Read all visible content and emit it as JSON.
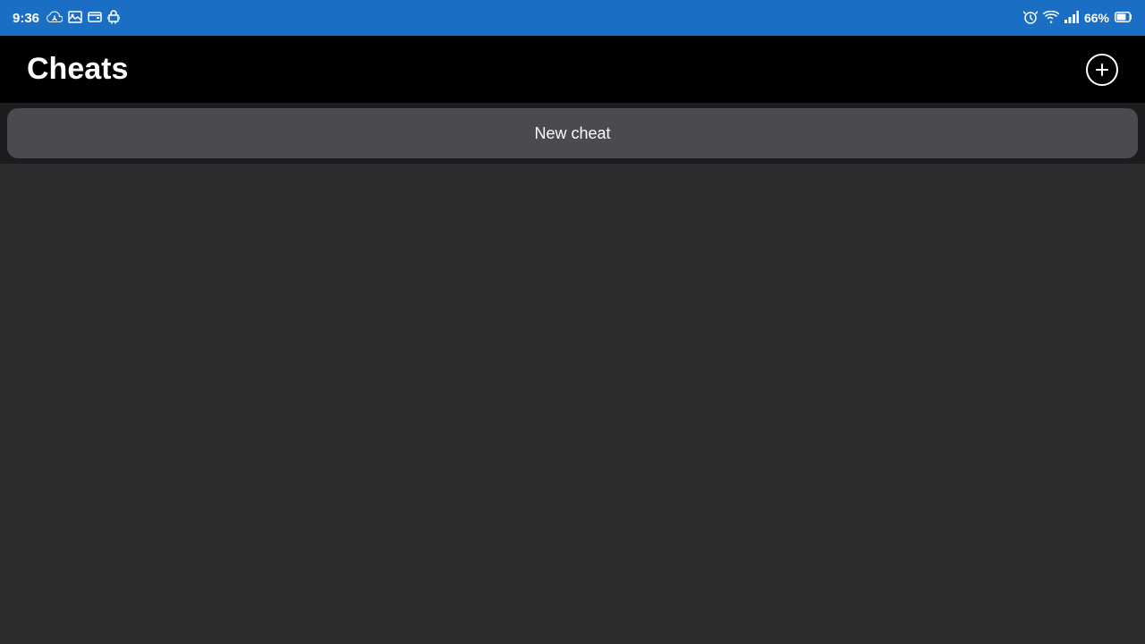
{
  "statusBar": {
    "time": "9:36",
    "batteryPercent": "66%",
    "leftIcons": [
      "alarm-icon",
      "sync-icon",
      "image-icon",
      "wallet-icon",
      "android-icon"
    ],
    "rightIcons": [
      "alarm-active-icon",
      "wifi-icon",
      "signal-icon",
      "battery-icon"
    ]
  },
  "header": {
    "title": "Cheats",
    "addButtonLabel": "+"
  },
  "newCheatButton": {
    "label": "New cheat"
  }
}
